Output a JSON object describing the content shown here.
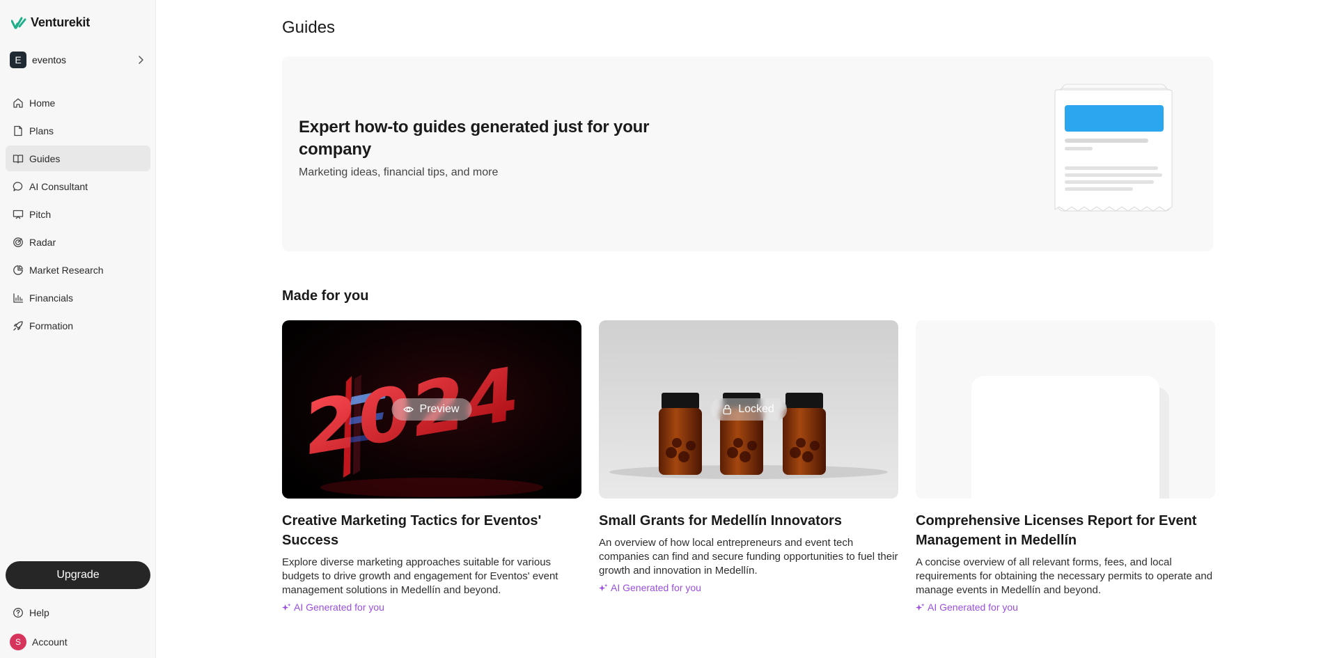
{
  "brand": {
    "name": "Venturekit",
    "accent": "#1fae8a"
  },
  "workspace": {
    "initial": "E",
    "name": "eventos"
  },
  "sidebar": {
    "items": [
      {
        "label": "Home",
        "icon": "home-icon"
      },
      {
        "label": "Plans",
        "icon": "document-icon"
      },
      {
        "label": "Guides",
        "icon": "book-icon",
        "active": true
      },
      {
        "label": "AI Consultant",
        "icon": "chat-bubble-icon"
      },
      {
        "label": "Pitch",
        "icon": "presentation-icon"
      },
      {
        "label": "Radar",
        "icon": "radar-icon"
      },
      {
        "label": "Market Research",
        "icon": "pie-chart-icon"
      },
      {
        "label": "Financials",
        "icon": "bar-chart-icon"
      },
      {
        "label": "Formation",
        "icon": "rocket-icon"
      }
    ],
    "upgrade_label": "Upgrade",
    "help_label": "Help",
    "account": {
      "initial": "S",
      "label": "Account"
    }
  },
  "page": {
    "title": "Guides"
  },
  "hero": {
    "title": "Expert how-to guides generated just for your company",
    "subtitle": "Marketing ideas, financial tips, and more"
  },
  "section": {
    "title": "Made for you"
  },
  "cards": [
    {
      "title": "Creative Marketing Tactics for Eventos' Success",
      "description": "Explore diverse marketing approaches suitable for various budgets to drive growth and engagement for Eventos' event management solutions in Medellín and beyond.",
      "tag": "AI Generated for you",
      "overlay": "Preview",
      "image_text": "2024"
    },
    {
      "title": "Small Grants for Medellín Innovators",
      "description": "An overview of how local entrepreneurs and event tech companies can find and secure funding opportunities to fuel their growth and innovation in Medellín.",
      "tag": "AI Generated for you",
      "overlay": "Locked"
    },
    {
      "title": "Comprehensive Licenses Report for Event Management in Medellín",
      "description": "A concise overview of all relevant forms, fees, and local requirements for obtaining the necessary permits to operate and manage events in Medellín and beyond.",
      "tag": "AI Generated for you"
    }
  ],
  "colors": {
    "ai_tag": "#9a4ee0",
    "hero_bar": "#2aa7ee"
  }
}
